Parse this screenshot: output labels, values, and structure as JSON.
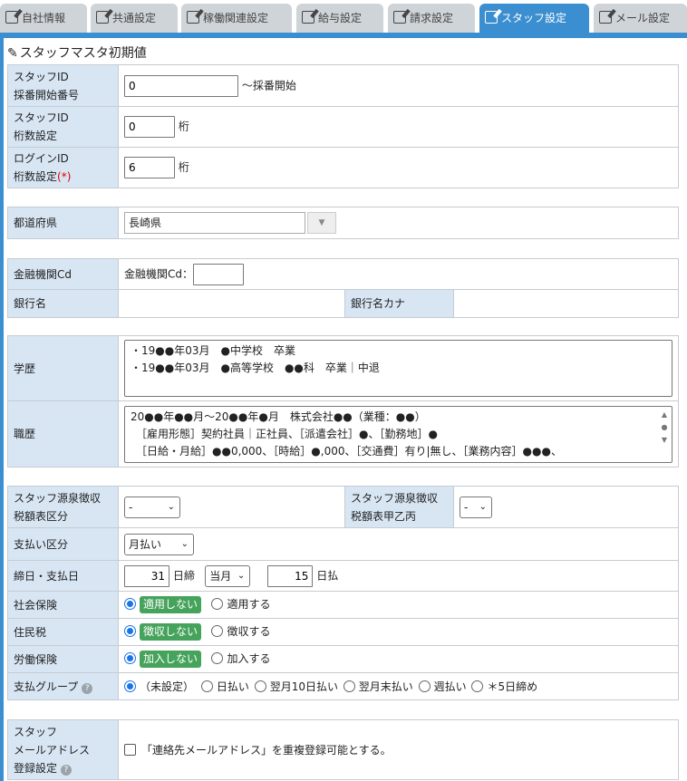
{
  "tabs": [
    {
      "label": "自社情報",
      "active": false
    },
    {
      "label": "共通設定",
      "active": false
    },
    {
      "label": "稼働関連設定",
      "active": false
    },
    {
      "label": "給与設定",
      "active": false
    },
    {
      "label": "請求設定",
      "active": false
    },
    {
      "label": "スタッフ設定",
      "active": true
    },
    {
      "label": "メール設定",
      "active": false
    }
  ],
  "section_title": "スタッフマスタ初期値",
  "staff_id_start": {
    "label1": "スタッフID",
    "label2": "採番開始番号",
    "value": "0",
    "suffix": "～採番開始"
  },
  "staff_id_digits": {
    "label1": "スタッフID",
    "label2": "桁数設定",
    "value": "0",
    "suffix": "桁"
  },
  "login_id_digits": {
    "label1": "ログインID",
    "label2": "桁数設定",
    "required": "(*)",
    "value": "6",
    "suffix": "桁"
  },
  "prefecture": {
    "label": "都道府県",
    "value": "長崎県"
  },
  "bank": {
    "code_label": "金融機関Cd",
    "code_inline_label": "金融機関Cd：",
    "code_value": "",
    "name_label": "銀行名",
    "kana_label": "銀行名カナ"
  },
  "education": {
    "label": "学歴",
    "lines": [
      "・19●●年03月　●中学校　卒業",
      "・19●●年03月　●高等学校　●●科　卒業｜中退"
    ]
  },
  "career": {
    "label": "職歴",
    "lines": [
      "20●●年●●月～20●●年●月　株式会社●●（業種：●●）",
      "　［雇用形態］契約社員｜正社員、［派遣会社］●、［勤務地］●",
      "　［日給・月給］●●0,000、［時給］●,000、［交通費］有り|無し、［業務内容］●●●、"
    ]
  },
  "tax": {
    "label1": "スタッフ源泉徴収",
    "label2": "税額表区分",
    "value": "-",
    "label3": "スタッフ源泉徴収",
    "label4": "税額表甲乙丙",
    "value2": "-"
  },
  "payment_type": {
    "label": "支払い区分",
    "value": "月払い"
  },
  "closing": {
    "label": "締日・支払日",
    "close_day": "31",
    "close_suffix": "日締",
    "month": "当月",
    "pay_day": "15",
    "pay_suffix": "日払"
  },
  "social_insurance": {
    "label": "社会保険",
    "opt1": "適用しない",
    "opt2": "適用する"
  },
  "resident_tax": {
    "label": "住民税",
    "opt1": "徴収しない",
    "opt2": "徴収する"
  },
  "labor_insurance": {
    "label": "労働保険",
    "opt1": "加入しない",
    "opt2": "加入する"
  },
  "pay_group": {
    "label": "支払グループ",
    "options": [
      "（未設定）",
      "日払い",
      "翌月10日払い",
      "翌月末払い",
      "週払い",
      "＊5日締め"
    ]
  },
  "staff_mail": {
    "label1": "スタッフ",
    "label2": "メールアドレス",
    "label3": "登録設定",
    "checkbox_label": "「連絡先メールアドレス」を重複登録可能とする。"
  },
  "colors": {
    "tab_active": "#3b8fd0",
    "label_bg": "#d8e6f4",
    "badge_green": "#46a35c",
    "radio_blue": "#1a73e8"
  }
}
